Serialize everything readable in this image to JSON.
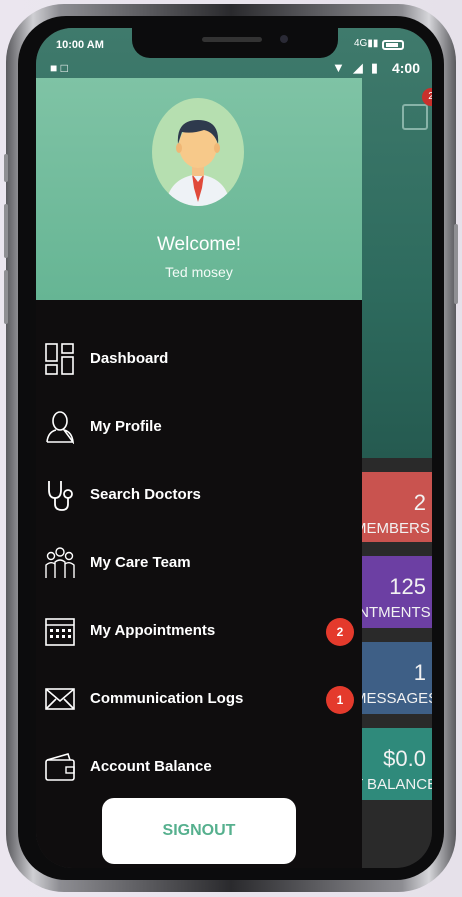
{
  "status_bar": {
    "time": "10:00 AM",
    "network": "4G",
    "clock": "4:00"
  },
  "drawer": {
    "welcome": "Welcome!",
    "user_name": "Ted mosey",
    "menu": [
      {
        "label": "Dashboard",
        "icon": "dashboard-icon"
      },
      {
        "label": "My Profile",
        "icon": "profile-icon"
      },
      {
        "label": "Search Doctors",
        "icon": "stethoscope-icon"
      },
      {
        "label": "My Care Team",
        "icon": "care-team-icon"
      },
      {
        "label": "My Appointments",
        "icon": "calendar-icon",
        "badge": "2"
      },
      {
        "label": "Communication Logs",
        "icon": "envelope-icon",
        "badge": "1"
      },
      {
        "label": "Account Balance",
        "icon": "wallet-icon"
      }
    ],
    "signout": "SIGNOUT"
  },
  "background": {
    "calendar_badge": "2",
    "tiles": [
      {
        "value": "2",
        "label": "MEMBERS",
        "color": "#c9534f"
      },
      {
        "value": "125",
        "label": "INTMENTS",
        "color": "#6c3fa3"
      },
      {
        "value": "1",
        "label": "MESSAGES",
        "color": "#3e5f86"
      },
      {
        "value": "$0.0",
        "label": "T BALANCE",
        "color": "#2f8a7b"
      }
    ]
  },
  "colors": {
    "drawer_header": "#6fb99a",
    "drawer_bg": "#0f0d0e",
    "badge": "#e43a2c",
    "signout_text": "#56b08e"
  }
}
